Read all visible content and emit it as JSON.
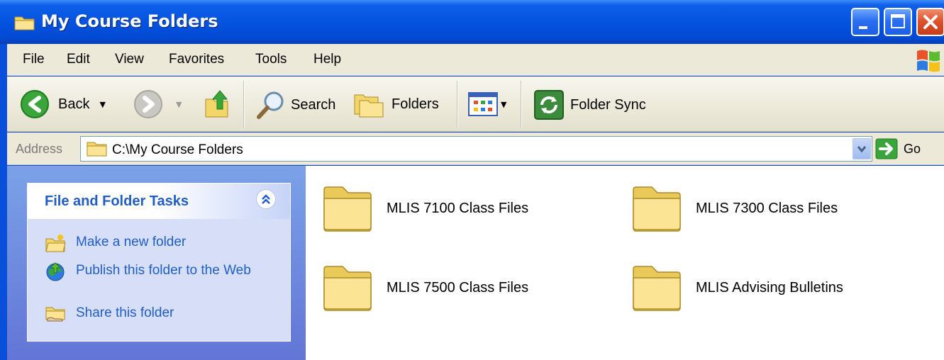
{
  "window": {
    "title": "My Course Folders"
  },
  "menu": {
    "items": [
      "File",
      "Edit",
      "View",
      "Favorites",
      "Tools",
      "Help"
    ]
  },
  "toolbar": {
    "back_label": "Back",
    "search_label": "Search",
    "folders_label": "Folders",
    "folder_sync_label": "Folder Sync"
  },
  "address": {
    "label": "Address",
    "value": "C:\\My Course Folders",
    "go_label": "Go"
  },
  "tasks": {
    "title": "File and Folder Tasks",
    "items": [
      {
        "label": "Make a new folder",
        "icon": "new-folder-icon"
      },
      {
        "label": "Publish this folder to the Web",
        "icon": "publish-web-icon"
      },
      {
        "label": "Share this folder",
        "icon": "share-folder-icon"
      }
    ]
  },
  "folders": [
    {
      "name": "MLIS 7100 Class Files"
    },
    {
      "name": "MLIS 7300 Class Files"
    },
    {
      "name": "MLIS 7500 Class Files"
    },
    {
      "name": "MLIS Advising Bulletins"
    }
  ],
  "colors": {
    "titlebar": "#0553e0",
    "task_link": "#215dc6",
    "pane_gradient_top": "#7ba2e7",
    "chrome": "#ece9d8"
  }
}
